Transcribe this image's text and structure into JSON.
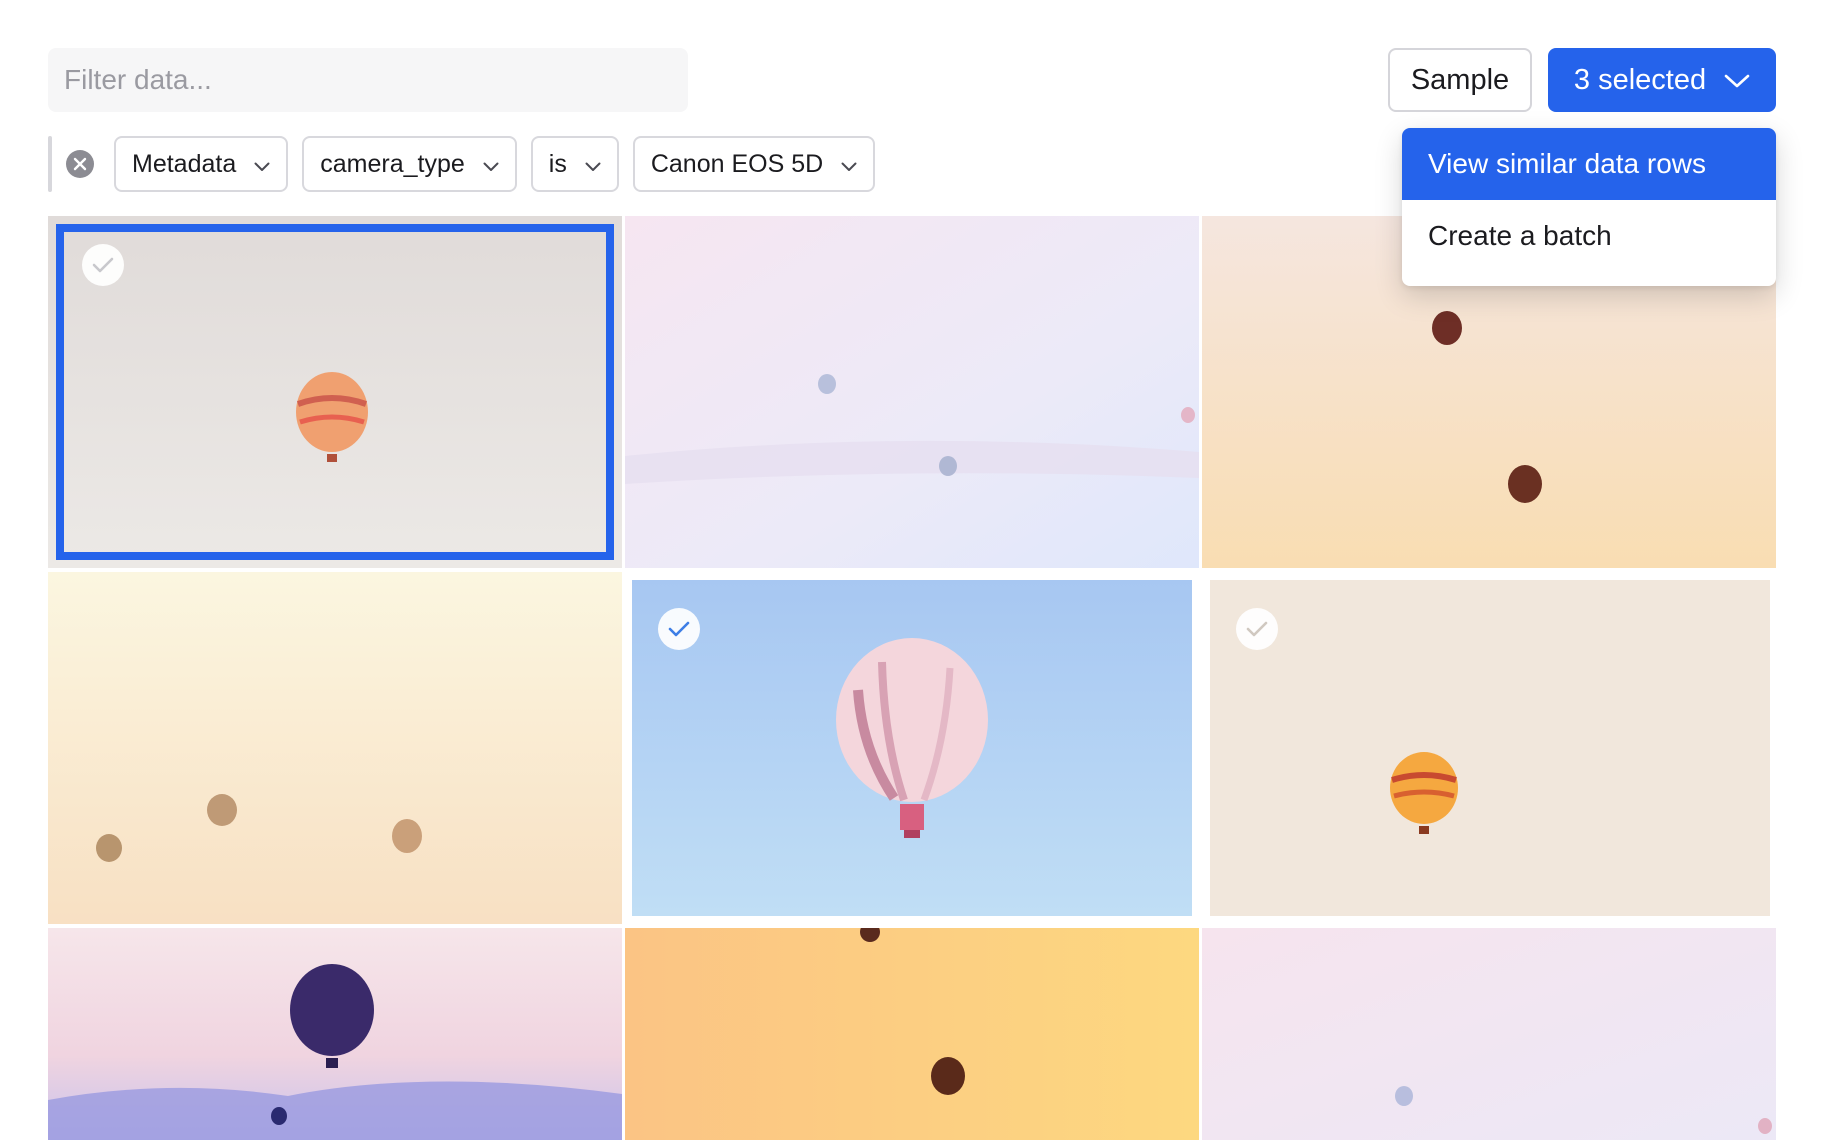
{
  "search": {
    "placeholder": "Filter data..."
  },
  "toolbar": {
    "sample_label": "Sample",
    "selected_label": "3 selected"
  },
  "filters": {
    "field": "Metadata",
    "key": "camera_type",
    "operator": "is",
    "value": "Canon EOS 5D"
  },
  "menu": {
    "items": [
      {
        "label": "View similar data rows",
        "active": true
      },
      {
        "label": "Create a batch",
        "active": false
      }
    ]
  },
  "grid": {
    "tiles": [
      {
        "selected": true
      },
      {
        "selected": false
      },
      {
        "selected": false
      },
      {
        "selected": false
      },
      {
        "selected": true
      },
      {
        "selected": true
      },
      {
        "selected": false
      },
      {
        "selected": false
      },
      {
        "selected": false
      }
    ]
  },
  "colors": {
    "accent": "#2563eb",
    "border": "#d8d8dd",
    "muted_text": "#9a9aa1"
  },
  "icons": [
    "chevron-down-icon",
    "clear-filter-icon",
    "check-icon"
  ]
}
